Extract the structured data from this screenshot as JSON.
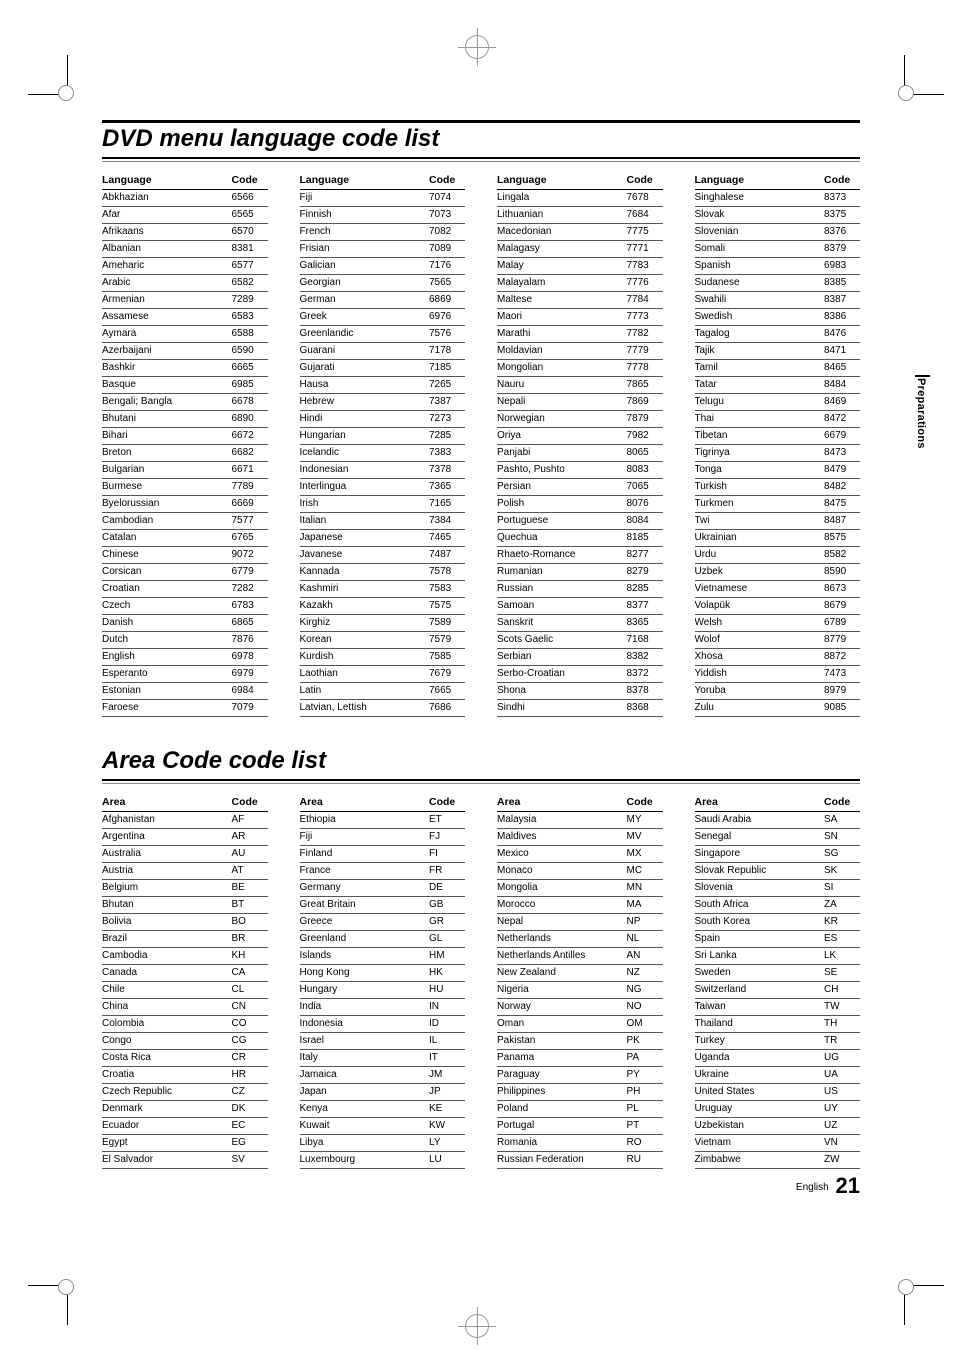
{
  "titles": {
    "lang": "DVD menu language code list",
    "area": "Area Code code list"
  },
  "sideTab": "Preparations",
  "footer": {
    "label": "English",
    "page": "21"
  },
  "langHeader": {
    "k": "Language",
    "v": "Code"
  },
  "areaHeader": {
    "k": "Area",
    "v": "Code"
  },
  "langCols": [
    [
      [
        "Abkhazian",
        "6566"
      ],
      [
        "Afar",
        "6565"
      ],
      [
        "Afrikaans",
        "6570"
      ],
      [
        "Albanian",
        "8381"
      ],
      [
        "Ameharic",
        "6577"
      ],
      [
        "Arabic",
        "6582"
      ],
      [
        "Armenian",
        "7289"
      ],
      [
        "Assamese",
        "6583"
      ],
      [
        "Aymara",
        "6588"
      ],
      [
        "Azerbaijani",
        "6590"
      ],
      [
        "Bashkir",
        "6665"
      ],
      [
        "Basque",
        "6985"
      ],
      [
        "Bengali; Bangla",
        "6678"
      ],
      [
        "Bhutani",
        "6890"
      ],
      [
        "Bihari",
        "6672"
      ],
      [
        "Breton",
        "6682"
      ],
      [
        "Bulgarian",
        "6671"
      ],
      [
        "Burmese",
        "7789"
      ],
      [
        "Byelorussian",
        "6669"
      ],
      [
        "Cambodian",
        "7577"
      ],
      [
        "Catalan",
        "6765"
      ],
      [
        "Chinese",
        "9072"
      ],
      [
        "Corsican",
        "6779"
      ],
      [
        "Croatian",
        "7282"
      ],
      [
        "Czech",
        "6783"
      ],
      [
        "Danish",
        "6865"
      ],
      [
        "Dutch",
        "7876"
      ],
      [
        "English",
        "6978"
      ],
      [
        "Esperanto",
        "6979"
      ],
      [
        "Estonian",
        "6984"
      ],
      [
        "Faroese",
        "7079"
      ]
    ],
    [
      [
        "Fiji",
        "7074"
      ],
      [
        "Finnish",
        "7073"
      ],
      [
        "French",
        "7082"
      ],
      [
        "Frisian",
        "7089"
      ],
      [
        "Galician",
        "7176"
      ],
      [
        "Georgian",
        "7565"
      ],
      [
        "German",
        "6869"
      ],
      [
        "Greek",
        "6976"
      ],
      [
        "Greenlandic",
        "7576"
      ],
      [
        "Guarani",
        "7178"
      ],
      [
        "Gujarati",
        "7185"
      ],
      [
        "Hausa",
        "7265"
      ],
      [
        "Hebrew",
        "7387"
      ],
      [
        "Hindi",
        "7273"
      ],
      [
        "Hungarian",
        "7285"
      ],
      [
        "Icelandic",
        "7383"
      ],
      [
        "Indonesian",
        "7378"
      ],
      [
        "Interlingua",
        "7365"
      ],
      [
        "Irish",
        "7165"
      ],
      [
        "Italian",
        "7384"
      ],
      [
        "Japanese",
        "7465"
      ],
      [
        "Javanese",
        "7487"
      ],
      [
        "Kannada",
        "7578"
      ],
      [
        "Kashmiri",
        "7583"
      ],
      [
        "Kazakh",
        "7575"
      ],
      [
        "Kirghiz",
        "7589"
      ],
      [
        "Korean",
        "7579"
      ],
      [
        "Kurdish",
        "7585"
      ],
      [
        "Laothian",
        "7679"
      ],
      [
        "Latin",
        "7665"
      ],
      [
        "Latvian, Lettish",
        "7686"
      ]
    ],
    [
      [
        "Lingala",
        "7678"
      ],
      [
        "Lithuanian",
        "7684"
      ],
      [
        "Macedonian",
        "7775"
      ],
      [
        "Malagasy",
        "7771"
      ],
      [
        "Malay",
        "7783"
      ],
      [
        "Malayalam",
        "7776"
      ],
      [
        "Maltese",
        "7784"
      ],
      [
        "Maori",
        "7773"
      ],
      [
        "Marathi",
        "7782"
      ],
      [
        "Moldavian",
        "7779"
      ],
      [
        "Mongolian",
        "7778"
      ],
      [
        "Nauru",
        "7865"
      ],
      [
        "Nepali",
        "7869"
      ],
      [
        "Norwegian",
        "7879"
      ],
      [
        "Oriya",
        "7982"
      ],
      [
        "Panjabi",
        "8065"
      ],
      [
        "Pashto, Pushto",
        "8083"
      ],
      [
        "Persian",
        "7065"
      ],
      [
        "Polish",
        "8076"
      ],
      [
        "Portuguese",
        "8084"
      ],
      [
        "Quechua",
        "8185"
      ],
      [
        "Rhaeto-Romance",
        "8277"
      ],
      [
        "Rumanian",
        "8279"
      ],
      [
        "Russian",
        "8285"
      ],
      [
        "Samoan",
        "8377"
      ],
      [
        "Sanskrit",
        "8365"
      ],
      [
        "Scots Gaelic",
        "7168"
      ],
      [
        "Serbian",
        "8382"
      ],
      [
        "Serbo-Croatian",
        "8372"
      ],
      [
        "Shona",
        "8378"
      ],
      [
        "Sindhi",
        "8368"
      ]
    ],
    [
      [
        "Singhalese",
        "8373"
      ],
      [
        "Slovak",
        "8375"
      ],
      [
        "Slovenian",
        "8376"
      ],
      [
        "Somali",
        "8379"
      ],
      [
        "Spanish",
        "6983"
      ],
      [
        "Sudanese",
        "8385"
      ],
      [
        "Swahili",
        "8387"
      ],
      [
        "Swedish",
        "8386"
      ],
      [
        "Tagalog",
        "8476"
      ],
      [
        "Tajik",
        "8471"
      ],
      [
        "Tamil",
        "8465"
      ],
      [
        "Tatar",
        "8484"
      ],
      [
        "Telugu",
        "8469"
      ],
      [
        "Thai",
        "8472"
      ],
      [
        "Tibetan",
        "6679"
      ],
      [
        "Tigrinya",
        "8473"
      ],
      [
        "Tonga",
        "8479"
      ],
      [
        "Turkish",
        "8482"
      ],
      [
        "Turkmen",
        "8475"
      ],
      [
        "Twi",
        "8487"
      ],
      [
        "Ukrainian",
        "8575"
      ],
      [
        "Urdu",
        "8582"
      ],
      [
        "Uzbek",
        "8590"
      ],
      [
        "Vietnamese",
        "8673"
      ],
      [
        "Volapük",
        "8679"
      ],
      [
        "Welsh",
        "6789"
      ],
      [
        "Wolof",
        "8779"
      ],
      [
        "Xhosa",
        "8872"
      ],
      [
        "Yiddish",
        "7473"
      ],
      [
        "Yoruba",
        "8979"
      ],
      [
        "Zulu",
        "9085"
      ]
    ]
  ],
  "areaCols": [
    [
      [
        "Afghanistan",
        "AF"
      ],
      [
        "Argentina",
        "AR"
      ],
      [
        "Australia",
        "AU"
      ],
      [
        "Austria",
        "AT"
      ],
      [
        "Belgium",
        "BE"
      ],
      [
        "Bhutan",
        "BT"
      ],
      [
        "Bolivia",
        "BO"
      ],
      [
        "Brazil",
        "BR"
      ],
      [
        "Cambodia",
        "KH"
      ],
      [
        "Canada",
        "CA"
      ],
      [
        "Chile",
        "CL"
      ],
      [
        "China",
        "CN"
      ],
      [
        "Colombia",
        "CO"
      ],
      [
        "Congo",
        "CG"
      ],
      [
        "Costa Rica",
        "CR"
      ],
      [
        "Croatia",
        "HR"
      ],
      [
        "Czech Republic",
        "CZ"
      ],
      [
        "Denmark",
        "DK"
      ],
      [
        "Ecuador",
        "EC"
      ],
      [
        "Egypt",
        "EG"
      ],
      [
        "El Salvador",
        "SV"
      ]
    ],
    [
      [
        "Ethiopia",
        "ET"
      ],
      [
        "Fiji",
        "FJ"
      ],
      [
        "Finland",
        "FI"
      ],
      [
        "France",
        "FR"
      ],
      [
        "Germany",
        "DE"
      ],
      [
        "Great Britain",
        "GB"
      ],
      [
        "Greece",
        "GR"
      ],
      [
        "Greenland",
        "GL"
      ],
      [
        "Islands",
        "HM"
      ],
      [
        "Hong Kong",
        "HK"
      ],
      [
        "Hungary",
        "HU"
      ],
      [
        "India",
        "IN"
      ],
      [
        "Indonesia",
        "ID"
      ],
      [
        "Israel",
        "IL"
      ],
      [
        "Italy",
        "IT"
      ],
      [
        "Jamaica",
        "JM"
      ],
      [
        "Japan",
        "JP"
      ],
      [
        "Kenya",
        "KE"
      ],
      [
        "Kuwait",
        "KW"
      ],
      [
        "Libya",
        "LY"
      ],
      [
        "Luxembourg",
        "LU"
      ]
    ],
    [
      [
        "Malaysia",
        "MY"
      ],
      [
        "Maldives",
        "MV"
      ],
      [
        "Mexico",
        "MX"
      ],
      [
        "Monaco",
        "MC"
      ],
      [
        "Mongolia",
        "MN"
      ],
      [
        "Morocco",
        "MA"
      ],
      [
        "Nepal",
        "NP"
      ],
      [
        "Netherlands",
        "NL"
      ],
      [
        "Netherlands Antilles",
        "AN"
      ],
      [
        "New Zealand",
        "NZ"
      ],
      [
        "Nigeria",
        "NG"
      ],
      [
        "Norway",
        "NO"
      ],
      [
        "Oman",
        "OM"
      ],
      [
        "Pakistan",
        "PK"
      ],
      [
        "Panama",
        "PA"
      ],
      [
        "Paraguay",
        "PY"
      ],
      [
        "Philippines",
        "PH"
      ],
      [
        "Poland",
        "PL"
      ],
      [
        "Portugal",
        "PT"
      ],
      [
        "Romania",
        "RO"
      ],
      [
        "Russian Federation",
        "RU"
      ]
    ],
    [
      [
        "Saudi Arabia",
        "SA"
      ],
      [
        "Senegal",
        "SN"
      ],
      [
        "Singapore",
        "SG"
      ],
      [
        "Slovak Republic",
        "SK"
      ],
      [
        "Slovenia",
        "SI"
      ],
      [
        "South Africa",
        "ZA"
      ],
      [
        "South Korea",
        "KR"
      ],
      [
        "Spain",
        "ES"
      ],
      [
        "Sri Lanka",
        "LK"
      ],
      [
        "Sweden",
        "SE"
      ],
      [
        "Switzerland",
        "CH"
      ],
      [
        "Taiwan",
        "TW"
      ],
      [
        "Thailand",
        "TH"
      ],
      [
        "Turkey",
        "TR"
      ],
      [
        "Uganda",
        "UG"
      ],
      [
        "Ukraine",
        "UA"
      ],
      [
        "United States",
        "US"
      ],
      [
        "Uruguay",
        "UY"
      ],
      [
        "Uzbekistan",
        "UZ"
      ],
      [
        "Vietnam",
        "VN"
      ],
      [
        "Zimbabwe",
        "ZW"
      ]
    ]
  ]
}
